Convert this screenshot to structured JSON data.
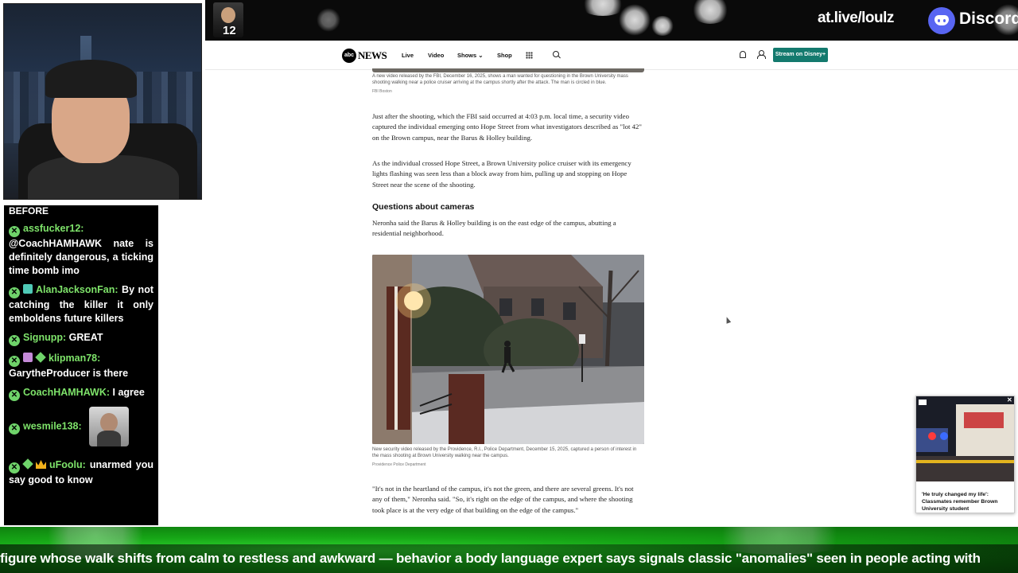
{
  "banner": {
    "mini_avatar_number": "12",
    "social_handle": "at.live/loulz",
    "discord_label": "Discord"
  },
  "chat": {
    "top_text": "BEFORE",
    "messages": [
      {
        "user": "assfucker12:",
        "text": "@CoachHAMHAWK nate is definitely dangerous, a ticking time bomb imo"
      },
      {
        "user": "AlanJacksonFan:",
        "text": "By not catching the killer it only emboldens future killers"
      },
      {
        "user": "Signupp:",
        "text": "GREAT"
      },
      {
        "user": "klipman78:",
        "text": "GarytheProducer is there"
      },
      {
        "user": "CoachHAMHAWK:",
        "text": "I agree"
      },
      {
        "user": "wesmile138:",
        "text": ""
      },
      {
        "user": "uFoolu:",
        "text": "unarmed you say good to know"
      }
    ]
  },
  "nav": {
    "logo_mark": "abc",
    "logo_text": "NEWS",
    "items": [
      "Live",
      "Video",
      "Shows",
      "Shop"
    ],
    "stream_button": "Stream on Disney+"
  },
  "article": {
    "top_caption": "A new video released by the FBI, December 16, 2025, shows a man wanted for questioning in the Brown University mass shooting walking near a police cruiser arriving at the campus shortly after the attack. The man is circled in blue.",
    "top_credit": "FBI Boston",
    "para1": "Just after the shooting, which the FBI said occurred at 4:03 p.m. local time, a security video captured the individual emerging onto Hope Street from what investigators described as \"lot 42\" on the Brown campus, near the Barus & Holley building.",
    "para2": "As the individual crossed Hope Street, a Brown University police cruiser with its emergency lights flashing was seen less than a block away from him, pulling up and stopping on Hope Street near the scene of the shooting.",
    "heading": "Questions about cameras",
    "para3": "Neronha said the Barus & Holley building is on the east edge of the campus, abutting a residential neighborhood.",
    "photo_caption": "New security video released by the Providence, R.I., Police Department, December 15, 2025, captured a person of interest in the mass shooting at Brown University walking near the campus.",
    "photo_credit": "Providence Police Department",
    "para4": "\"It's not in the heartland of the campus, it's not the green, and there are several greens. It's not any of them,\" Neronha said. \"So, it's right on the edge of the campus, and where the shooting took place is at the very edge of that building on the edge of the campus.\""
  },
  "popup": {
    "title": "'He truly changed my life': Classmates remember Brown University student",
    "close_label": "✕"
  },
  "ticker": {
    "text": "figure whose walk shifts from calm to restless and awkward — behavior a body language expert says signals classic \"anomalies\" seen in people acting with"
  }
}
